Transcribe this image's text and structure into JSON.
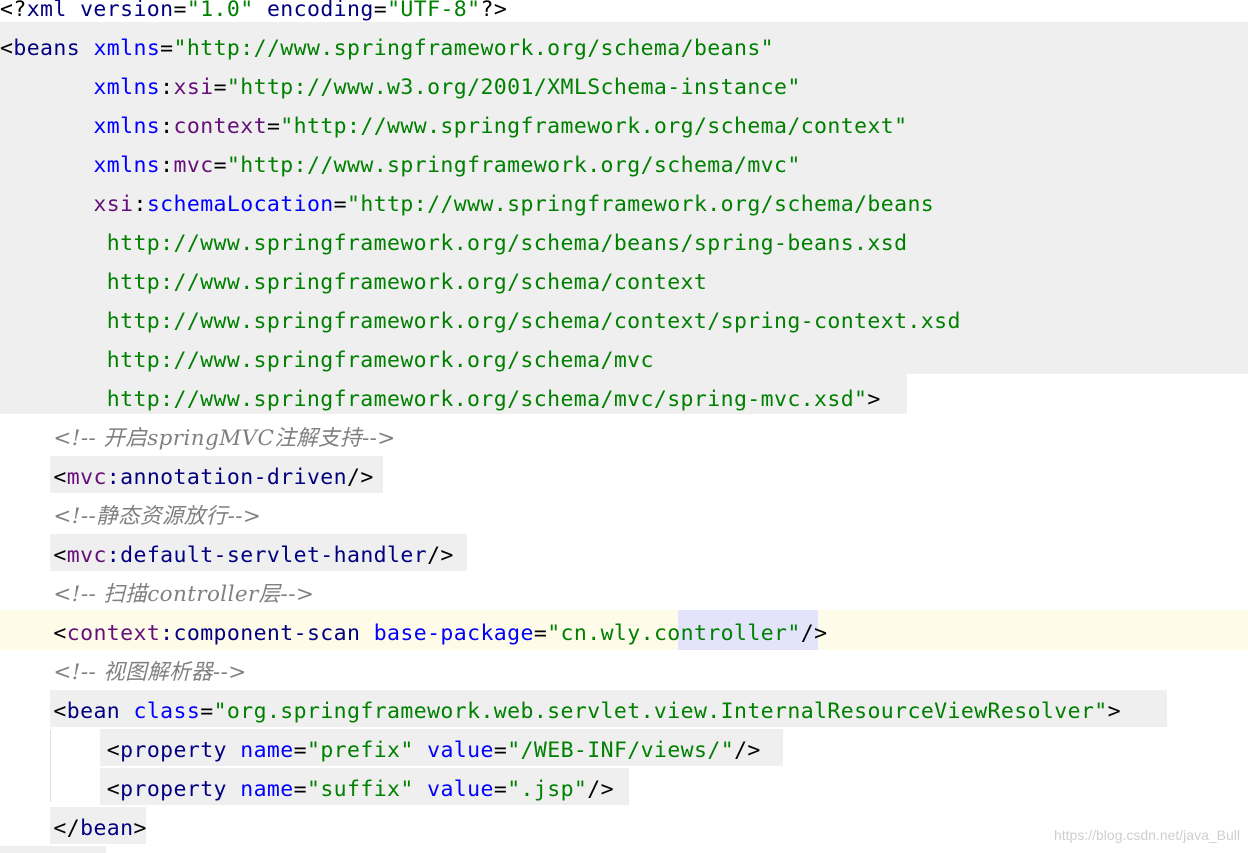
{
  "editor": {
    "lines": [
      [
        [
          "p",
          "<?"
        ],
        [
          "t",
          "xml version"
        ],
        [
          "p",
          "="
        ],
        [
          "v",
          "\"1.0\""
        ],
        [
          "p",
          " "
        ],
        [
          "t",
          "encoding"
        ],
        [
          "p",
          "="
        ],
        [
          "v",
          "\"UTF-8\""
        ],
        [
          "p",
          "?>"
        ]
      ],
      [
        [
          "b",
          "<"
        ],
        [
          "t",
          "beans "
        ],
        [
          "a",
          "xmlns"
        ],
        [
          "p",
          "="
        ],
        [
          "v",
          "\"http://www.springframework.org/schema/beans\""
        ]
      ],
      [
        [
          "p",
          "       "
        ],
        [
          "a",
          "xmlns"
        ],
        [
          "p",
          ":"
        ],
        [
          "ns",
          "xsi"
        ],
        [
          "p",
          "="
        ],
        [
          "v",
          "\"http://www.w3.org/2001/XMLSchema-instance\""
        ]
      ],
      [
        [
          "p",
          "       "
        ],
        [
          "a",
          "xmlns"
        ],
        [
          "p",
          ":"
        ],
        [
          "ns",
          "context"
        ],
        [
          "p",
          "="
        ],
        [
          "v",
          "\"http://www.springframework.org/schema/context\""
        ]
      ],
      [
        [
          "p",
          "       "
        ],
        [
          "a",
          "xmlns"
        ],
        [
          "p",
          ":"
        ],
        [
          "ns",
          "mvc"
        ],
        [
          "p",
          "="
        ],
        [
          "v",
          "\"http://www.springframework.org/schema/mvc\""
        ]
      ],
      [
        [
          "p",
          "       "
        ],
        [
          "ns",
          "xsi"
        ],
        [
          "p",
          ":"
        ],
        [
          "a",
          "schemaLocation"
        ],
        [
          "p",
          "="
        ],
        [
          "v",
          "\"http://www.springframework.org/schema/beans"
        ]
      ],
      [
        [
          "p",
          "        "
        ],
        [
          "v",
          "http://www.springframework.org/schema/beans/spring-beans.xsd"
        ]
      ],
      [
        [
          "p",
          "        "
        ],
        [
          "v",
          "http://www.springframework.org/schema/context"
        ]
      ],
      [
        [
          "p",
          "        "
        ],
        [
          "v",
          "http://www.springframework.org/schema/context/spring-context.xsd"
        ]
      ],
      [
        [
          "p",
          "        "
        ],
        [
          "v",
          "http://www.springframework.org/schema/mvc"
        ]
      ],
      [
        [
          "p",
          "        "
        ],
        [
          "v",
          "http://www.springframework.org/schema/mvc/spring-mvc.xsd\""
        ],
        [
          "b",
          ">"
        ]
      ],
      [
        [
          "p",
          "    "
        ],
        [
          "c",
          "<!-- 开启springMVC注解支持-->"
        ]
      ],
      [
        [
          "p",
          "    "
        ],
        [
          "b",
          "<"
        ],
        [
          "ns",
          "mvc"
        ],
        [
          "t",
          ":annotation-driven"
        ],
        [
          "b",
          "/>"
        ]
      ],
      [
        [
          "p",
          "    "
        ],
        [
          "c",
          "<!--静态资源放行-->"
        ]
      ],
      [
        [
          "p",
          "    "
        ],
        [
          "b",
          "<"
        ],
        [
          "ns",
          "mvc"
        ],
        [
          "t",
          ":default-servlet-handler"
        ],
        [
          "b",
          "/>"
        ]
      ],
      [
        [
          "p",
          "    "
        ],
        [
          "c",
          "<!-- 扫描controller层-->"
        ]
      ],
      [
        [
          "p",
          "    "
        ],
        [
          "b",
          "<"
        ],
        [
          "ns",
          "context"
        ],
        [
          "t",
          ":component-scan "
        ],
        [
          "a",
          "base-package"
        ],
        [
          "p",
          "="
        ],
        [
          "v",
          "\"cn.wly.controller\""
        ],
        [
          "b",
          "/>"
        ]
      ],
      [
        [
          "p",
          "    "
        ],
        [
          "c",
          "<!-- 视图解析器-->"
        ]
      ],
      [
        [
          "p",
          "    "
        ],
        [
          "b",
          "<"
        ],
        [
          "t",
          "bean "
        ],
        [
          "a",
          "class"
        ],
        [
          "p",
          "="
        ],
        [
          "v",
          "\"org.springframework.web.servlet.view.InternalResourceViewResolver\""
        ],
        [
          "b",
          ">"
        ]
      ],
      [
        [
          "p",
          "        "
        ],
        [
          "b",
          "<"
        ],
        [
          "t",
          "property "
        ],
        [
          "a",
          "name"
        ],
        [
          "p",
          "="
        ],
        [
          "v",
          "\"prefix\""
        ],
        [
          "p",
          " "
        ],
        [
          "a",
          "value"
        ],
        [
          "p",
          "="
        ],
        [
          "v",
          "\"/WEB-INF/views/\""
        ],
        [
          "b",
          "/>"
        ]
      ],
      [
        [
          "p",
          "        "
        ],
        [
          "b",
          "<"
        ],
        [
          "t",
          "property "
        ],
        [
          "a",
          "name"
        ],
        [
          "p",
          "="
        ],
        [
          "v",
          "\"suffix\""
        ],
        [
          "p",
          " "
        ],
        [
          "a",
          "value"
        ],
        [
          "p",
          "="
        ],
        [
          "v",
          "\".jsp\""
        ],
        [
          "b",
          "/>"
        ]
      ],
      [
        [
          "p",
          "    "
        ],
        [
          "b",
          "</"
        ],
        [
          "t",
          "bean"
        ],
        [
          "b",
          ">"
        ]
      ]
    ]
  },
  "watermark": "https://blog.csdn.net/java_Bull"
}
